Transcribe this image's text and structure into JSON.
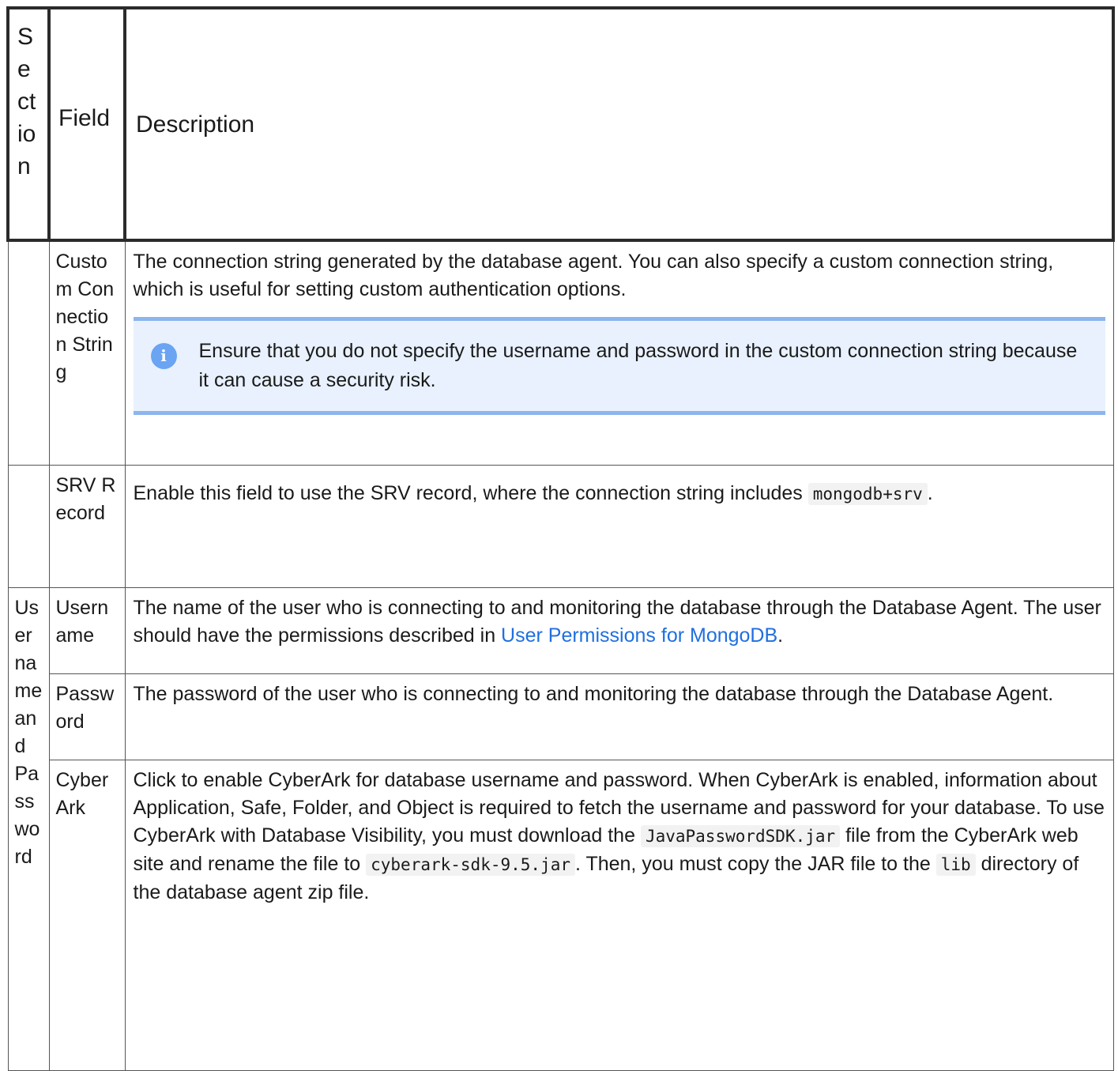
{
  "headers": {
    "section": "Section",
    "field": "Field",
    "description": "Description"
  },
  "rows": {
    "custom_connection_string": {
      "field": "Custom Connection String",
      "description": "The connection string generated by the database agent. You can also specify a custom connection string, which is useful for setting custom authentication options.",
      "note": "Ensure that you do not specify the username and password in the custom connection string because it can cause a security risk."
    },
    "srv_record": {
      "field": "SRV Record",
      "description_prefix": "Enable this field to use the SRV record, where the connection string includes ",
      "code": "mongodb+srv",
      "description_suffix": "."
    },
    "username_password_section": "Username and Password",
    "username": {
      "field": "Username",
      "description_prefix": "The name of the user who is connecting to and monitoring the database through the Database Agent. The user should have the permissions described in ",
      "link": "User Permissions for MongoDB",
      "description_suffix": "."
    },
    "password": {
      "field": "Password",
      "description": "The password of the user who is connecting to and monitoring the database through the Database Agent."
    },
    "cyberark": {
      "field": "CyberArk",
      "text1": "Click to enable CyberArk for database username and password. When CyberArk is enabled, information about Application, Safe, Folder, and Object is required to fetch the username and password for your database. To use CyberArk with Database Visibility, you must download the ",
      "code1": "JavaPasswordSDK.jar",
      "text2": " file from the CyberArk web site and rename the file to ",
      "code2": "cyberark-sdk-9.5.jar",
      "text3": ". Then, you must copy the JAR file to the ",
      "code3": "lib",
      "text4": " directory of the database agent zip file."
    }
  },
  "icons": {
    "note_icon": "info-icon",
    "note_icon_glyph": "i"
  },
  "colors": {
    "note_background": "#e8f1fd",
    "note_border": "#8db5ee",
    "link": "#1f6fe0",
    "info_icon": "#6aa4f2"
  }
}
